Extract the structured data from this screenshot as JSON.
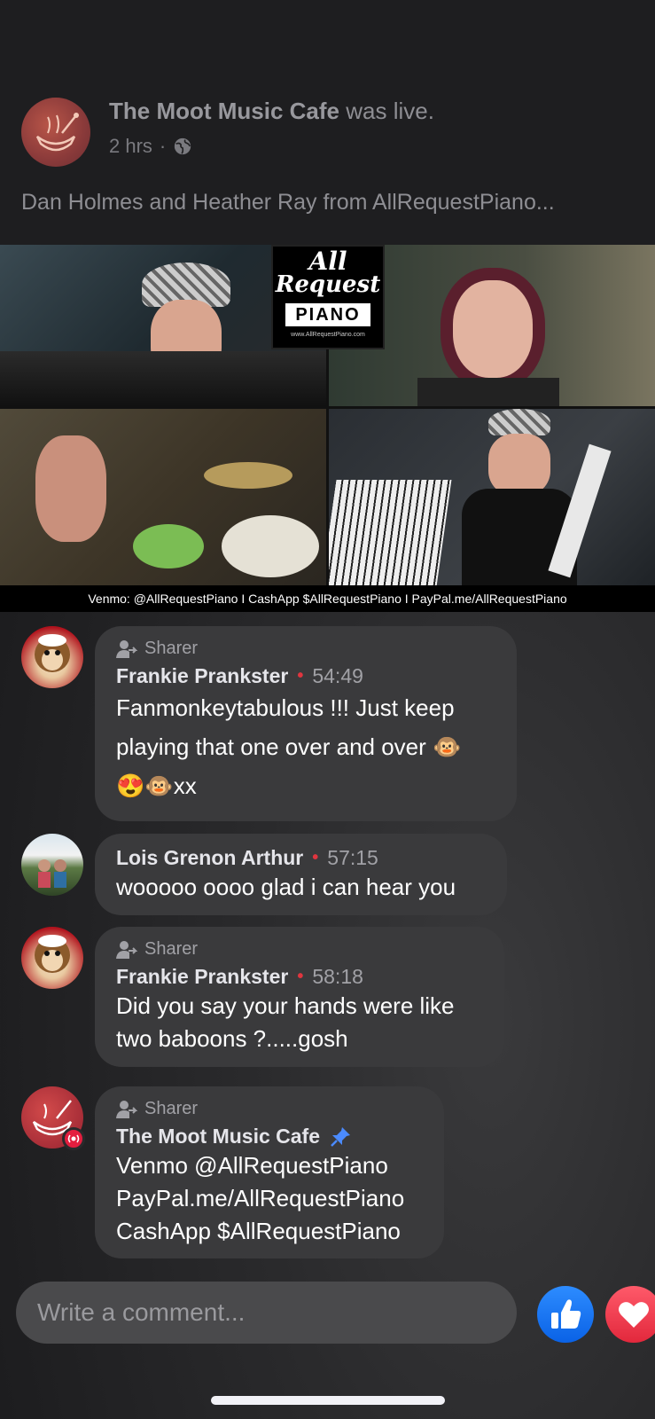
{
  "post": {
    "page_name": "The Moot Music Cafe",
    "status": "was live.",
    "time_ago": "2 hrs",
    "separator": "·",
    "caption": "Dan Holmes and Heather Ray from AllRequestPiano..."
  },
  "video": {
    "logo_line1": "All",
    "logo_line2": "Request",
    "logo_line3": "PIANO",
    "logo_url": "www.AllRequestPiano.com",
    "banner": "Venmo: @AllRequestPiano  I  CashApp $AllRequestPiano  I  PayPal.me/AllRequestPiano"
  },
  "comments": [
    {
      "sharer_label": "Sharer",
      "author": "Frankie Prankster",
      "time": "54:49",
      "lines": [
        "Fanmonkeytabulous !!! Just keep",
        "playing that one over and over 🐵",
        "😍🐵xx"
      ]
    },
    {
      "author": "Lois Grenon Arthur",
      "time": "57:15",
      "lines": [
        "wooooo oooo glad i can hear you"
      ]
    },
    {
      "sharer_label": "Sharer",
      "author": "Frankie Prankster",
      "time": "58:18",
      "lines": [
        "Did you say your hands were like",
        "two baboons ?.....gosh"
      ]
    },
    {
      "sharer_label": "Sharer",
      "author": "The Moot Music Cafe",
      "pinned": true,
      "lines": [
        "Venmo @AllRequestPiano",
        "PayPal.me/AllRequestPiano",
        "CashApp $AllRequestPiano"
      ]
    }
  ],
  "composer": {
    "placeholder": "Write a comment..."
  },
  "icons": {
    "like": "thumbs-up-icon",
    "love": "heart-icon",
    "pin": "pin-icon",
    "sharer": "share-person-icon",
    "globe": "globe-icon"
  },
  "colors": {
    "like_blue": "#1877f2",
    "love_red": "#f33e58",
    "live_dot": "#e0353f",
    "pin_blue": "#4b8bff"
  }
}
